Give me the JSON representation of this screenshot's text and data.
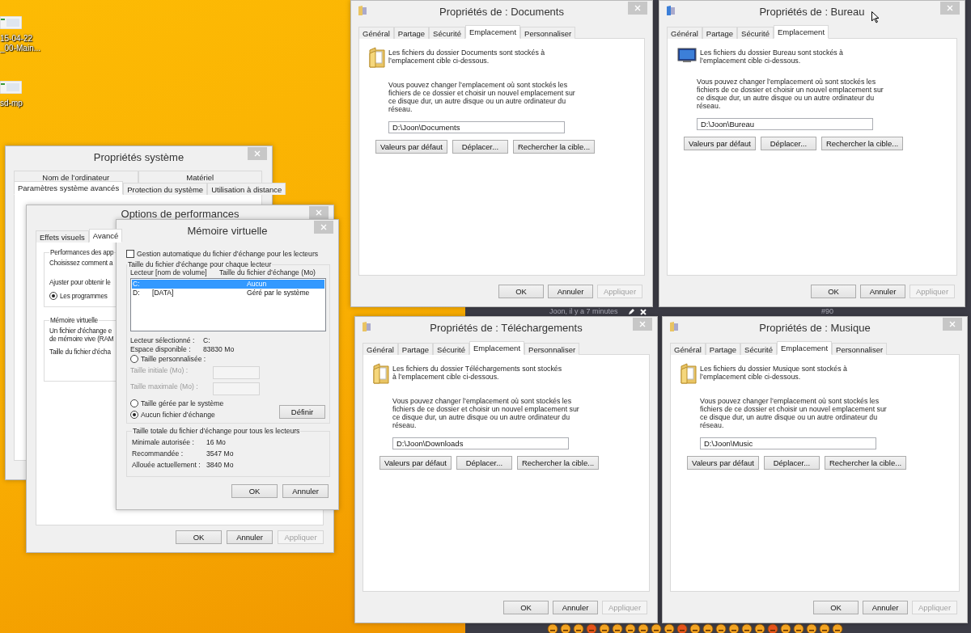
{
  "desktop_icons": [
    {
      "lines": [
        "15-04-22",
        "_00-Main..."
      ]
    },
    {
      "lines": [
        "sd-mp"
      ]
    }
  ],
  "background_page": {
    "comment_meta": "Joon, il y a 7 minutes",
    "post_number": "#90"
  },
  "windows": [
    {
      "kind": "system_properties",
      "title": "Propriétés système",
      "tab_rows": [
        {
          "tabs": [
            {
              "label": "Nom de l’ordinateur",
              "selected": false
            },
            {
              "label": "Matériel",
              "selected": false
            }
          ]
        },
        {
          "tabs": [
            {
              "label": "Paramètres système avancés",
              "selected": true
            },
            {
              "label": "Protection du système",
              "selected": false
            },
            {
              "label": "Utilisation à distance",
              "selected": false
            }
          ]
        }
      ]
    },
    {
      "kind": "performance_options",
      "title": "Options de performances",
      "tabs": [
        {
          "label": "Effets visuels",
          "selected": false
        },
        {
          "label": "Avancé",
          "selected": true
        }
      ],
      "groups": [
        {
          "title": "Performances des app",
          "items": [
            {
              "kind": "text",
              "lines": [
                "Choisissez comment a"
              ]
            },
            {
              "kind": "text",
              "lines": [
                "Ajuster pour obtenir le"
              ]
            },
            {
              "kind": "radio",
              "label": "Les programmes",
              "selected": true
            }
          ]
        },
        {
          "title": "Mémoire virtuelle",
          "items": [
            {
              "kind": "text",
              "lines": [
                "Un fichier d’échange e",
                "de mémoire vive (RAM"
              ]
            },
            {
              "kind": "text",
              "lines": [
                "Taille du fichier d’écha"
              ]
            }
          ]
        }
      ],
      "footer_buttons": [
        {
          "label": "OK",
          "disabled": false
        },
        {
          "label": "Annuler",
          "disabled": false
        },
        {
          "label": "Appliquer",
          "disabled": true
        }
      ]
    },
    {
      "kind": "virtual_memory",
      "title": "Mémoire virtuelle",
      "auto_manage": {
        "label": "Gestion automatique du fichier d’échange pour les lecteurs",
        "checked": false
      },
      "drives_group": {
        "title": "Taille du fichier d’échange pour chaque lecteur",
        "columns": [
          "Lecteur [nom de volume]",
          "Taille du fichier d’échange (Mo)"
        ],
        "drives": [
          {
            "drive": "C:",
            "size": "Aucun",
            "selected": true
          },
          {
            "drive": "D:",
            "volume": "[DATA]",
            "size": "Géré par le système",
            "selected": false
          }
        ],
        "info": [
          {
            "label": "Lecteur sélectionné :",
            "value": "C:"
          },
          {
            "label": "Espace disponible :",
            "value": "83830 Mo"
          }
        ],
        "size_options": [
          {
            "label": "Taille personnalisée :",
            "selected": false
          },
          {
            "label": "Taille gérée par le système",
            "selected": false
          },
          {
            "label": "Aucun fichier d’échange",
            "selected": true
          }
        ],
        "custom_fields": [
          {
            "label": "Taille initiale (Mo) :",
            "disabled": true
          },
          {
            "label": "Taille maximale (Mo) :",
            "disabled": true
          }
        ],
        "set_button": "Définir"
      },
      "totals_group": {
        "title": "Taille totale du fichier d’échange pour tous les lecteurs",
        "rows": [
          {
            "label": "Minimale autorisée :",
            "value": "16 Mo"
          },
          {
            "label": "Recommandée :",
            "value": "3547 Mo"
          },
          {
            "label": "Allouée actuellement :",
            "value": "3840 Mo"
          }
        ]
      },
      "footer_buttons": [
        {
          "label": "OK",
          "disabled": false
        },
        {
          "label": "Annuler",
          "disabled": false
        }
      ]
    },
    {
      "kind": "folder_properties",
      "title": "Propriétés de : Documents",
      "tabs": [
        {
          "label": "Général",
          "selected": false
        },
        {
          "label": "Partage",
          "selected": false
        },
        {
          "label": "Sécurité",
          "selected": false
        },
        {
          "label": "Emplacement",
          "selected": true
        },
        {
          "label": "Personnaliser",
          "selected": false
        }
      ],
      "message": "Les fichiers du dossier Documents sont stockés à l’emplacement cible ci-dessous.",
      "explanation": "Vous pouvez changer l’emplacement où sont stockés les fichiers de ce dossier et choisir un nouvel emplacement sur ce disque dur, un autre disque ou un autre ordinateur du réseau.",
      "path": "D:\\Joon\\Documents",
      "buttons": [
        "Valeurs par défaut",
        "Déplacer...",
        "Rechercher la cible..."
      ],
      "footer_buttons": [
        {
          "label": "OK",
          "disabled": false
        },
        {
          "label": "Annuler",
          "disabled": false
        },
        {
          "label": "Appliquer",
          "disabled": true
        }
      ]
    },
    {
      "kind": "folder_properties",
      "title": "Propriétés de : Bureau",
      "tabs": [
        {
          "label": "Général",
          "selected": false
        },
        {
          "label": "Partage",
          "selected": false
        },
        {
          "label": "Sécurité",
          "selected": false
        },
        {
          "label": "Emplacement",
          "selected": true
        }
      ],
      "message": "Les fichiers du dossier Bureau sont stockés à l’emplacement cible ci-dessous.",
      "explanation": "Vous pouvez changer l’emplacement où sont stockés les fichiers de ce dossier et choisir un nouvel emplacement sur ce disque dur, un autre disque ou un autre ordinateur du réseau.",
      "path": "D:\\Joon\\Bureau",
      "buttons": [
        "Valeurs par défaut",
        "Déplacer...",
        "Rechercher la cible..."
      ],
      "footer_buttons": [
        {
          "label": "OK",
          "disabled": false
        },
        {
          "label": "Annuler",
          "disabled": false
        },
        {
          "label": "Appliquer",
          "disabled": true
        }
      ]
    },
    {
      "kind": "folder_properties",
      "title": "Propriétés de : Téléchargements",
      "tabs": [
        {
          "label": "Général",
          "selected": false
        },
        {
          "label": "Partage",
          "selected": false
        },
        {
          "label": "Sécurité",
          "selected": false
        },
        {
          "label": "Emplacement",
          "selected": true
        },
        {
          "label": "Personnaliser",
          "selected": false
        }
      ],
      "message": "Les fichiers du dossier Téléchargements sont stockés à l’emplacement cible ci-dessous.",
      "explanation": "Vous pouvez changer l’emplacement où sont stockés les fichiers de ce dossier et choisir un nouvel emplacement sur ce disque dur, un autre disque ou un autre ordinateur du réseau.",
      "path": "D:\\Joon\\Downloads",
      "buttons": [
        "Valeurs par défaut",
        "Déplacer...",
        "Rechercher la cible..."
      ],
      "footer_buttons": [
        {
          "label": "OK",
          "disabled": false
        },
        {
          "label": "Annuler",
          "disabled": false
        },
        {
          "label": "Appliquer",
          "disabled": true
        }
      ]
    },
    {
      "kind": "folder_properties",
      "title": "Propriétés de : Musique",
      "tabs": [
        {
          "label": "Général",
          "selected": false
        },
        {
          "label": "Partage",
          "selected": false
        },
        {
          "label": "Sécurité",
          "selected": false
        },
        {
          "label": "Emplacement",
          "selected": true
        },
        {
          "label": "Personnaliser",
          "selected": false
        }
      ],
      "message": "Les fichiers du dossier Musique sont stockés à l’emplacement cible ci-dessous.",
      "explanation": "Vous pouvez changer l’emplacement où sont stockés les fichiers de ce dossier et choisir un nouvel emplacement sur ce disque dur, un autre disque ou un autre ordinateur du réseau.",
      "path": "D:\\Joon\\Music",
      "buttons": [
        "Valeurs par défaut",
        "Déplacer...",
        "Rechercher la cible..."
      ],
      "footer_buttons": [
        {
          "label": "OK",
          "disabled": false
        },
        {
          "label": "Annuler",
          "disabled": false
        },
        {
          "label": "Appliquer",
          "disabled": true
        }
      ]
    }
  ]
}
